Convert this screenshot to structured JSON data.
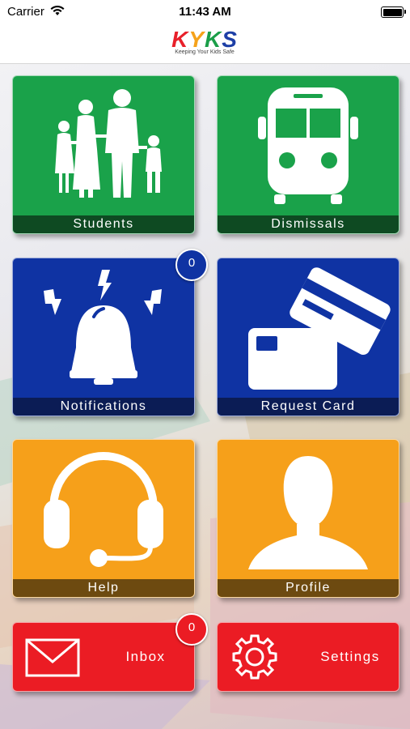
{
  "status_bar": {
    "carrier": "Carrier",
    "time": "11:43 AM"
  },
  "header": {
    "logo_letters": [
      "K",
      "Y",
      "K",
      "S"
    ],
    "logo_colors": [
      "#e8202a",
      "#f5a21b",
      "#1a9e48",
      "#1d3fa6"
    ],
    "tagline": "Keeping Your Kids Safe"
  },
  "tiles": {
    "students": {
      "label": "Students",
      "color": "#1aa24a"
    },
    "dismissals": {
      "label": "Dismissals",
      "color": "#1aa24a"
    },
    "notifications": {
      "label": "Notifications",
      "color": "#0f33a3",
      "badge": "0"
    },
    "request_card": {
      "label": "Request Card",
      "color": "#0f33a3"
    },
    "help": {
      "label": "Help",
      "color": "#f6a01a"
    },
    "profile": {
      "label": "Profile",
      "color": "#f6a01a"
    },
    "inbox": {
      "label": "Inbox",
      "color": "#eb1c24",
      "badge": "0"
    },
    "settings": {
      "label": "Settings",
      "color": "#eb1c24"
    }
  },
  "icons": {
    "students": "family-icon",
    "dismissals": "bus-icon",
    "notifications": "alarm-bell-icon",
    "request_card": "cards-icon",
    "help": "headset-icon",
    "profile": "person-icon",
    "inbox": "envelope-icon",
    "settings": "gear-icon"
  }
}
